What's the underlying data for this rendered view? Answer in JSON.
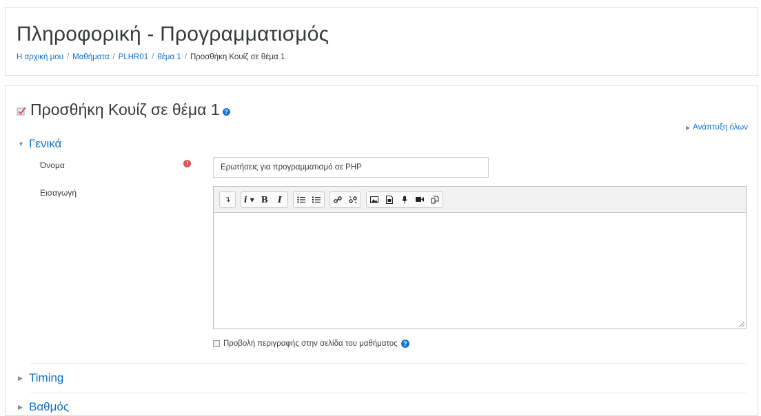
{
  "header": {
    "title": "Πληροφορική - Προγραμματισμός",
    "breadcrumb": [
      {
        "label": "Η αρχική μου"
      },
      {
        "label": "Μαθήματα"
      },
      {
        "label": "PLHR01"
      },
      {
        "label": "θέμα 1"
      },
      {
        "label": "Προσθήκη Κουίζ σε θέμα 1"
      }
    ]
  },
  "form": {
    "heading": "Προσθήκη Κουίζ σε θέμα 1",
    "expand_all": "Ανάπτυξη όλων",
    "sections": [
      {
        "label": "Γενικά",
        "expanded": true
      },
      {
        "label": "Timing",
        "expanded": false
      },
      {
        "label": "Βαθμός",
        "expanded": false
      }
    ],
    "name_label": "Όνομα",
    "name_value": "Ερωτήσεις για προγραμματισμό σε PHP",
    "intro_label": "Εισαγωγή",
    "intro_value": "",
    "show_description_label": "Προβολή περιγραφής στην σελίδα του μαθήματος",
    "show_description_checked": false
  },
  "colors": {
    "link": "#0f6fc5",
    "required": "#d9534f",
    "help": "#1177d1"
  }
}
